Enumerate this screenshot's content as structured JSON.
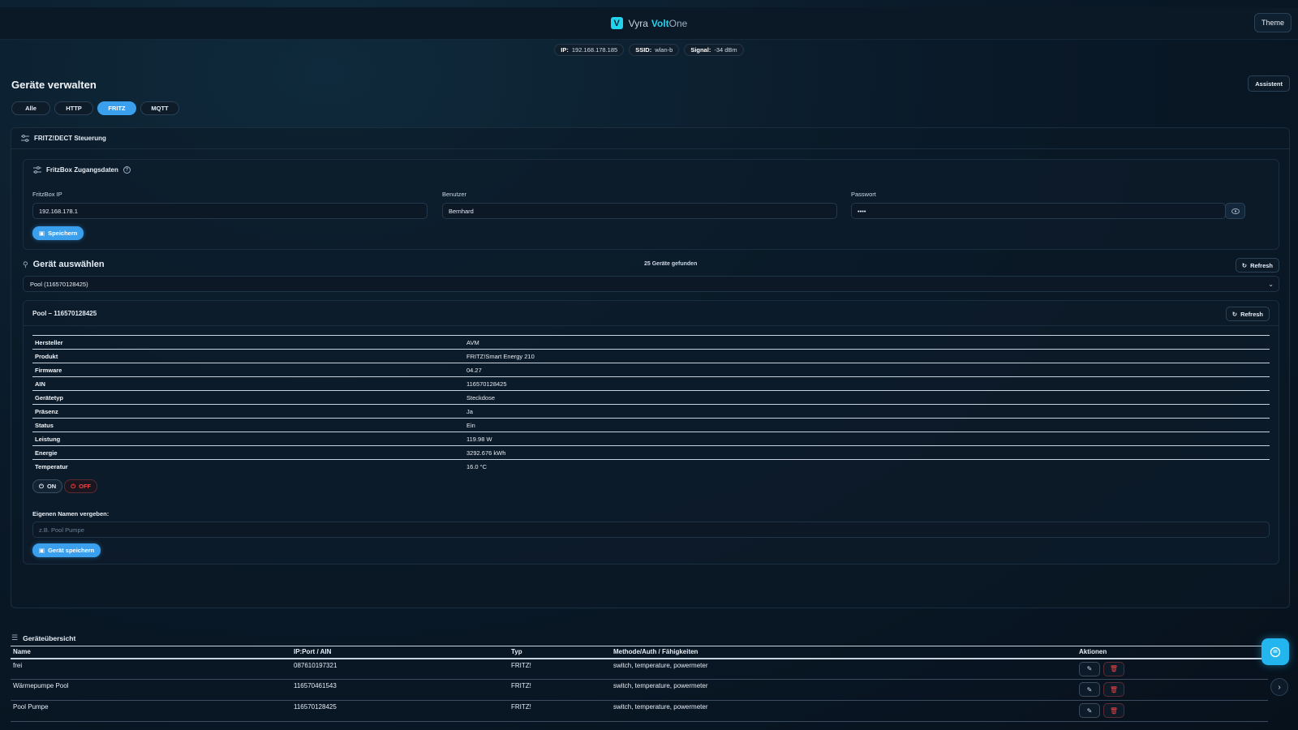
{
  "header": {
    "brand": {
      "part1": "Vyra",
      "part2": "Volt",
      "part3": "One",
      "logo_letter": "V"
    },
    "theme_label": "Theme"
  },
  "network": {
    "ip_label": "IP:",
    "ip_value": "192.168.178.185",
    "ssid_label": "SSID:",
    "ssid_value": "wlan-b",
    "signal_label": "Signal:",
    "signal_value": "-34 dBm"
  },
  "page": {
    "title": "Geräte verwalten",
    "assistant_label": "Assistent",
    "filter_tabs": [
      {
        "label": "Alle"
      },
      {
        "label": "HTTP"
      },
      {
        "label": "FRITZ"
      },
      {
        "label": "MQTT"
      }
    ],
    "active_filter": "FRITZ"
  },
  "fritz": {
    "section_title": "FRITZ!DECT Steuerung",
    "credentials": {
      "title": "FritzBox Zugangsdaten",
      "ip_label": "FritzBox IP",
      "ip_value": "192.168.178.1",
      "user_label": "Benutzer",
      "user_value": "Bernhard",
      "password_label": "Passwort",
      "password_value": "••••",
      "save_label": "Speichern"
    },
    "select": {
      "title": "Gerät auswählen",
      "found_text": "25 Geräte gefunden",
      "refresh_label": "Refresh",
      "selected_value": "Pool (116570128425)"
    },
    "detail": {
      "title": "Pool – 116570128425",
      "refresh_label": "Refresh",
      "properties": [
        {
          "key": "Hersteller",
          "value": "AVM"
        },
        {
          "key": "Produkt",
          "value": "FRITZ!Smart Energy 210"
        },
        {
          "key": "Firmware",
          "value": "04.27"
        },
        {
          "key": "AIN",
          "value": "116570128425"
        },
        {
          "key": "Gerätetyp",
          "value": "Steckdose"
        },
        {
          "key": "Präsenz",
          "value": "Ja"
        },
        {
          "key": "Status",
          "value": "Ein"
        },
        {
          "key": "Leistung",
          "value": "119.98 W"
        },
        {
          "key": "Energie",
          "value": "3292.676 kWh"
        },
        {
          "key": "Temperatur",
          "value": "16.0 °C"
        }
      ],
      "on_label": "ON",
      "off_label": "OFF",
      "name_label": "Eigenen Namen vergeben:",
      "name_placeholder": "z.B. Pool Pumpe",
      "save_device_label": "Gerät speichern"
    }
  },
  "overview": {
    "title": "Geräteübersicht",
    "columns": [
      "Name",
      "IP:Port / AIN",
      "Typ",
      "Methode/Auth / Fähigkeiten",
      "Aktionen"
    ],
    "rows": [
      {
        "name": "frei",
        "address": "087610197321",
        "type": "FRITZ!",
        "capabilities": "switch, temperature, powermeter"
      },
      {
        "name": "Wärmepumpe Pool",
        "address": "116570461543",
        "type": "FRITZ!",
        "capabilities": "switch, temperature, powermeter"
      },
      {
        "name": "Pool Pumpe",
        "address": "116570128425",
        "type": "FRITZ!",
        "capabilities": "switch, temperature, powermeter"
      }
    ]
  },
  "colors": {
    "accent": "#3aa0ee",
    "brand_cyan": "#22d3ee",
    "danger": "#ef4444",
    "background": "#0a1a29"
  },
  "icons": {
    "brand": "v-logo-icon",
    "help": "help-circle-icon",
    "eye": "eye-icon",
    "refresh": "refresh-icon",
    "chat": "chat-icon",
    "edit": "pencil-icon",
    "delete": "trash-icon"
  }
}
